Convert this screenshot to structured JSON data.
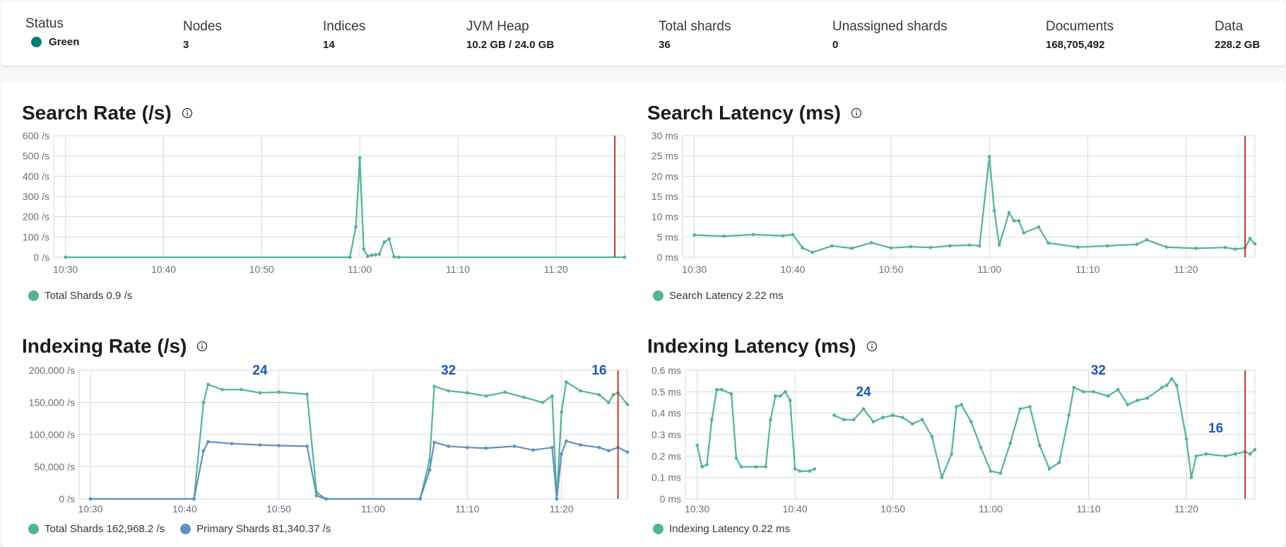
{
  "stats": {
    "status": {
      "title": "Status",
      "value": "Green",
      "color": "#017d73"
    },
    "nodes": {
      "title": "Nodes",
      "value": "3"
    },
    "indices": {
      "title": "Indices",
      "value": "14"
    },
    "jvm_heap": {
      "title": "JVM Heap",
      "value": "10.2 GB / 24.0 GB"
    },
    "total_shards": {
      "title": "Total shards",
      "value": "36"
    },
    "unassigned_shards": {
      "title": "Unassigned shards",
      "value": "0"
    },
    "documents": {
      "title": "Documents",
      "value": "168,705,492"
    },
    "data": {
      "title": "Data",
      "value": "228.2 GB"
    }
  },
  "colors": {
    "teal": "#54b399",
    "blue": "#6092c0",
    "marker": "#c0392b",
    "annotation": "#1a56b8",
    "grid": "#d3dae6"
  },
  "charts": {
    "search_rate": {
      "title": "Search Rate (/s)",
      "legend": [
        {
          "label": "Total Shards 0.9 /s",
          "color": "#54b399"
        }
      ]
    },
    "search_latency": {
      "title": "Search Latency (ms)",
      "legend": [
        {
          "label": "Search Latency 2.22 ms",
          "color": "#54b399"
        }
      ]
    },
    "indexing_rate": {
      "title": "Indexing Rate (/s)",
      "legend": [
        {
          "label": "Total Shards 162,968.2 /s",
          "color": "#54b399"
        },
        {
          "label": "Primary Shards 81,340.37 /s",
          "color": "#6092c0"
        }
      ]
    },
    "indexing_latency": {
      "title": "Indexing Latency (ms)",
      "legend": [
        {
          "label": "Indexing Latency 0.22 ms",
          "color": "#54b399"
        }
      ]
    }
  },
  "chart_data": [
    {
      "type": "line",
      "title": "Search Rate (/s)",
      "x_ticks": [
        "10:30",
        "10:40",
        "10:50",
        "11:00",
        "11:10",
        "11:20"
      ],
      "y_ticks": [
        "0 /s",
        "100 /s",
        "200 /s",
        "300 /s",
        "400 /s",
        "500 /s",
        "600 /s"
      ],
      "xlim": [
        10.48,
        11.45
      ],
      "ylim": [
        0,
        600
      ],
      "marker_x": 11.4333,
      "grid": true,
      "legend": "bottom-left",
      "series": [
        {
          "name": "Total Shards",
          "color": "#54b399",
          "points": [
            [
              10.5,
              0
            ],
            [
              10.9833,
              0
            ],
            [
              10.9933,
              150
            ],
            [
              11.0,
              490
            ],
            [
              11.0067,
              40
            ],
            [
              11.0133,
              5
            ],
            [
              11.02,
              10
            ],
            [
              11.0267,
              12
            ],
            [
              11.0333,
              15
            ],
            [
              11.0417,
              75
            ],
            [
              11.05,
              90
            ],
            [
              11.0583,
              2
            ],
            [
              11.0667,
              0
            ],
            [
              11.45,
              0
            ]
          ]
        }
      ]
    },
    {
      "type": "line",
      "title": "Search Latency (ms)",
      "x_ticks": [
        "10:30",
        "10:40",
        "10:50",
        "11:00",
        "11:10",
        "11:20"
      ],
      "y_ticks": [
        "0 ms",
        "5 ms",
        "10 ms",
        "15 ms",
        "20 ms",
        "25 ms",
        "30 ms"
      ],
      "xlim": [
        10.48,
        11.45
      ],
      "ylim": [
        0,
        30
      ],
      "marker_x": 11.4333,
      "grid": true,
      "legend": "bottom-left",
      "series": [
        {
          "name": "Search Latency",
          "color": "#54b399",
          "points": [
            [
              10.5,
              5.5
            ],
            [
              10.55,
              5.2
            ],
            [
              10.6,
              5.6
            ],
            [
              10.65,
              5.3
            ],
            [
              10.6667,
              5.6
            ],
            [
              10.6833,
              2.3
            ],
            [
              10.7,
              1.2
            ],
            [
              10.7333,
              2.8
            ],
            [
              10.7667,
              2.2
            ],
            [
              10.8,
              3.6
            ],
            [
              10.8333,
              2.3
            ],
            [
              10.8667,
              2.6
            ],
            [
              10.9,
              2.4
            ],
            [
              10.9333,
              2.8
            ],
            [
              10.9667,
              3.0
            ],
            [
              10.9833,
              2.8
            ],
            [
              11.0,
              24.8
            ],
            [
              11.0083,
              11.5
            ],
            [
              11.0167,
              3.0
            ],
            [
              11.0333,
              11.0
            ],
            [
              11.0417,
              9.0
            ],
            [
              11.05,
              9.0
            ],
            [
              11.0583,
              6.0
            ],
            [
              11.0833,
              7.5
            ],
            [
              11.1,
              3.5
            ],
            [
              11.15,
              2.5
            ],
            [
              11.2,
              2.8
            ],
            [
              11.25,
              3.2
            ],
            [
              11.2667,
              4.3
            ],
            [
              11.3,
              2.5
            ],
            [
              11.35,
              2.2
            ],
            [
              11.4,
              2.4
            ],
            [
              11.4167,
              2.0
            ],
            [
              11.4333,
              2.3
            ],
            [
              11.4417,
              4.6
            ],
            [
              11.45,
              3.3
            ]
          ]
        }
      ]
    },
    {
      "type": "line",
      "title": "Indexing Rate (/s)",
      "x_ticks": [
        "10:30",
        "10:40",
        "10:50",
        "11:00",
        "11:10",
        "11:20"
      ],
      "y_ticks": [
        "0 /s",
        "50,000 /s",
        "100,000 /s",
        "150,000 /s",
        "200,000 /s"
      ],
      "xlim": [
        10.48,
        11.45
      ],
      "ylim": [
        0,
        200000
      ],
      "marker_x": 11.4333,
      "grid": true,
      "legend": "bottom-left",
      "annotations": [
        {
          "x": 10.8,
          "text": "24"
        },
        {
          "x": 11.1333,
          "text": "32"
        },
        {
          "x": 11.4,
          "text": "16"
        }
      ],
      "series": [
        {
          "name": "Total Shards",
          "color": "#54b399",
          "points": [
            [
              10.5,
              0
            ],
            [
              10.6833,
              0
            ],
            [
              10.7,
              150000
            ],
            [
              10.7083,
              178000
            ],
            [
              10.7333,
              170000
            ],
            [
              10.7667,
              170000
            ],
            [
              10.8,
              165000
            ],
            [
              10.8333,
              166000
            ],
            [
              10.8833,
              163000
            ],
            [
              10.9,
              10000
            ],
            [
              10.9167,
              0
            ],
            [
              11.0833,
              0
            ],
            [
              11.1,
              60000
            ],
            [
              11.1083,
              175000
            ],
            [
              11.1333,
              168000
            ],
            [
              11.1667,
              165000
            ],
            [
              11.2,
              160000
            ],
            [
              11.2333,
              166000
            ],
            [
              11.2667,
              158000
            ],
            [
              11.3,
              150000
            ],
            [
              11.3167,
              160000
            ],
            [
              11.325,
              0
            ],
            [
              11.3333,
              135000
            ],
            [
              11.3417,
              182000
            ],
            [
              11.3667,
              168000
            ],
            [
              11.4,
              162000
            ],
            [
              11.4167,
              150000
            ],
            [
              11.425,
              162000
            ],
            [
              11.4333,
              165000
            ],
            [
              11.45,
              147000
            ]
          ]
        },
        {
          "name": "Primary Shards",
          "color": "#6092c0",
          "points": [
            [
              10.5,
              0
            ],
            [
              10.6833,
              0
            ],
            [
              10.7,
              75000
            ],
            [
              10.7083,
              89000
            ],
            [
              10.75,
              86000
            ],
            [
              10.8,
              84000
            ],
            [
              10.8333,
              83000
            ],
            [
              10.8833,
              82000
            ],
            [
              10.9,
              5000
            ],
            [
              10.9167,
              0
            ],
            [
              11.0833,
              0
            ],
            [
              11.1,
              45000
            ],
            [
              11.1083,
              88000
            ],
            [
              11.1333,
              82000
            ],
            [
              11.1667,
              80000
            ],
            [
              11.2,
              79000
            ],
            [
              11.25,
              82000
            ],
            [
              11.2833,
              76000
            ],
            [
              11.3167,
              80000
            ],
            [
              11.325,
              0
            ],
            [
              11.3333,
              70000
            ],
            [
              11.3417,
              90000
            ],
            [
              11.3667,
              84000
            ],
            [
              11.4,
              80000
            ],
            [
              11.4167,
              75000
            ],
            [
              11.4333,
              80000
            ],
            [
              11.45,
              73000
            ]
          ]
        }
      ]
    },
    {
      "type": "line",
      "title": "Indexing Latency (ms)",
      "x_ticks": [
        "10:30",
        "10:40",
        "10:50",
        "11:00",
        "11:10",
        "11:20"
      ],
      "y_ticks": [
        "0 ms",
        "0.1 ms",
        "0.2 ms",
        "0.3 ms",
        "0.4 ms",
        "0.5 ms",
        "0.6 ms"
      ],
      "xlim": [
        10.48,
        11.45
      ],
      "ylim": [
        0,
        0.6
      ],
      "marker_x": 11.4333,
      "grid": true,
      "legend": "bottom-left",
      "annotations": [
        {
          "x": 10.7833,
          "text": "24"
        },
        {
          "x": 11.1833,
          "text": "32"
        },
        {
          "x": 11.3833,
          "text": "16"
        }
      ],
      "series": [
        {
          "name": "Indexing Latency",
          "color": "#54b399",
          "points": [
            [
              10.5,
              0.25
            ],
            [
              10.5083,
              0.15
            ],
            [
              10.5167,
              0.16
            ],
            [
              10.525,
              0.37
            ],
            [
              10.5333,
              0.51
            ],
            [
              10.5417,
              0.51
            ],
            [
              10.5583,
              0.49
            ],
            [
              10.5667,
              0.19
            ],
            [
              10.575,
              0.15
            ],
            [
              10.6,
              0.15
            ],
            [
              10.6167,
              0.15
            ],
            [
              10.625,
              0.37
            ],
            [
              10.6333,
              0.48
            ],
            [
              10.6417,
              0.48
            ],
            [
              10.65,
              0.5
            ],
            [
              10.6583,
              0.46
            ],
            [
              10.6667,
              0.14
            ],
            [
              10.675,
              0.13
            ],
            [
              10.6917,
              0.13
            ],
            [
              10.7,
              0.14
            ],
            [
              10.7333,
              null
            ],
            [
              10.7333,
              0.39
            ],
            [
              10.75,
              0.37
            ],
            [
              10.7667,
              0.37
            ],
            [
              10.7833,
              0.42
            ],
            [
              10.8,
              0.36
            ],
            [
              10.8167,
              0.38
            ],
            [
              10.8333,
              0.39
            ],
            [
              10.85,
              0.38
            ],
            [
              10.8667,
              0.35
            ],
            [
              10.8833,
              0.37
            ],
            [
              10.9,
              0.29
            ],
            [
              10.9167,
              0.1
            ],
            [
              10.9333,
              0.21
            ],
            [
              10.9417,
              0.43
            ],
            [
              10.95,
              0.44
            ],
            [
              10.9667,
              0.36
            ],
            [
              10.9833,
              0.24
            ],
            [
              11.0,
              0.13
            ],
            [
              11.0167,
              0.12
            ],
            [
              11.0333,
              0.26
            ],
            [
              11.05,
              0.42
            ],
            [
              11.0667,
              0.43
            ],
            [
              11.0833,
              0.25
            ],
            [
              11.1,
              0.14
            ],
            [
              11.1167,
              0.17
            ],
            [
              11.1333,
              0.39
            ],
            [
              11.1417,
              0.52
            ],
            [
              11.1583,
              0.5
            ],
            [
              11.175,
              0.5
            ],
            [
              11.2,
              0.48
            ],
            [
              11.2167,
              0.51
            ],
            [
              11.2333,
              0.44
            ],
            [
              11.25,
              0.46
            ],
            [
              11.2667,
              0.47
            ],
            [
              11.2917,
              0.52
            ],
            [
              11.3,
              0.53
            ],
            [
              11.3083,
              0.56
            ],
            [
              11.3167,
              0.53
            ],
            [
              11.3333,
              0.28
            ],
            [
              11.3417,
              0.1
            ],
            [
              11.35,
              0.2
            ],
            [
              11.3667,
              0.21
            ],
            [
              11.4,
              0.2
            ],
            [
              11.4167,
              0.21
            ],
            [
              11.4333,
              0.22
            ],
            [
              11.4417,
              0.21
            ],
            [
              11.45,
              0.23
            ]
          ]
        }
      ]
    }
  ]
}
